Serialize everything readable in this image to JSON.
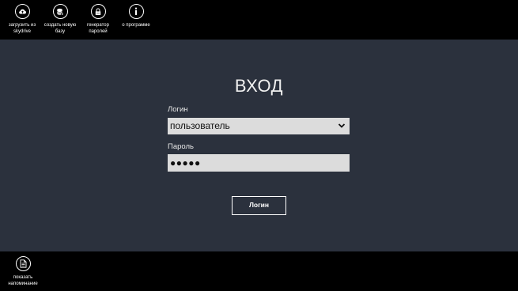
{
  "top_bar": {
    "items": [
      {
        "label": "загрузить из\nskydrive",
        "icon": "cloud-upload-icon"
      },
      {
        "label": "создать новую\nбазу",
        "icon": "new-database-icon"
      },
      {
        "label": "генератор\nпаролей",
        "icon": "password-generator-icon"
      },
      {
        "label": "о программе",
        "icon": "info-icon"
      }
    ]
  },
  "main": {
    "title": "ВХОД",
    "login_label": "Логин",
    "login_value": "пользователь",
    "password_label": "Пароль",
    "password_value": "●●●●●",
    "login_button": "Логин"
  },
  "bottom_bar": {
    "items": [
      {
        "label": "показать\nнапоминание",
        "icon": "document-icon"
      }
    ]
  },
  "colors": {
    "bar_background": "#000000",
    "main_background": "#2b313d",
    "field_background": "#dcdcdc",
    "text": "#ffffff"
  }
}
